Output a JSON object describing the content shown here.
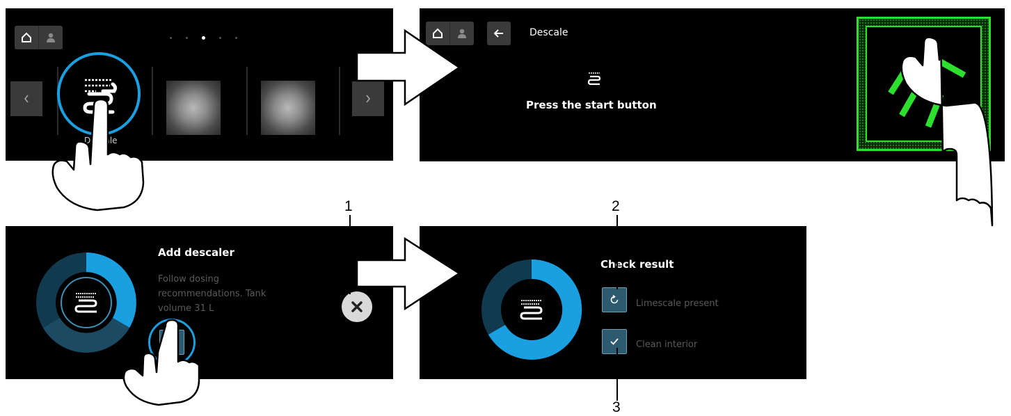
{
  "panel1": {
    "nav_prev_icon": "chevron-left-icon",
    "nav_next_icon": "chevron-right-icon",
    "selected_program_label": "Descale",
    "home_icon": "home-icon",
    "user_icon": "user-icon"
  },
  "panel2": {
    "title": "Descale",
    "instruction": "Press the start button",
    "back_icon": "back-arrow-icon",
    "start_button_color": "#2ee02e"
  },
  "panel3": {
    "title": "Add descaler",
    "body": "Follow dosing recommendations. Tank volume 31 L",
    "body_line1": "Follow dosing",
    "body_line2": "recommendations. Tank",
    "body_line3": "volume 31 L",
    "confirm_icon": "checkmark-icon",
    "cancel_icon": "close-icon"
  },
  "panel4": {
    "title": "Check result",
    "options": [
      {
        "label": "Limescale present",
        "icon": "repeat-icon"
      },
      {
        "label": "Clean interior",
        "icon": "checkmark-icon"
      }
    ]
  },
  "callouts": {
    "c1": "1",
    "c2": "2",
    "c3": "3"
  },
  "colors": {
    "accent_blue": "#1a9fe0",
    "dark_blue": "#123a4f",
    "mid_blue": "#1c4a62",
    "green": "#2ee02e"
  }
}
